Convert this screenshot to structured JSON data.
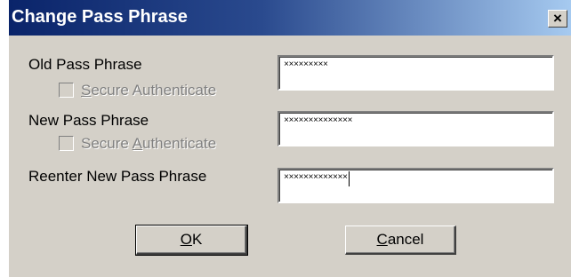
{
  "window": {
    "title": "Change Pass Phrase",
    "close_glyph": "×"
  },
  "fields": [
    {
      "label": "Old Pass Phrase",
      "value": "×××××××××",
      "checkbox": {
        "label_before": "",
        "mnemonic": "S",
        "label_after": "ecure Authenticate",
        "checked": false,
        "enabled": false
      }
    },
    {
      "label": "New Pass Phrase",
      "value": "××××××××××××××",
      "checkbox": {
        "label_before": "Secure ",
        "mnemonic": "A",
        "label_after": "uthenticate",
        "checked": false,
        "enabled": false
      }
    },
    {
      "label": "Reenter New Pass Phrase",
      "value": "×××××××××××××",
      "focused": true
    }
  ],
  "buttons": {
    "ok": {
      "mnemonic": "O",
      "rest": "K",
      "is_default": true
    },
    "cancel": {
      "mnemonic": "C",
      "rest": "ancel"
    }
  },
  "colors": {
    "title_gradient_start": "#0a246a",
    "title_gradient_end": "#a6caf0",
    "dialog_face": "#d4d0c8",
    "disabled_text": "#808080"
  },
  "icons": {
    "close": "close-icon",
    "checkbox": "checkbox-unchecked-icon"
  }
}
